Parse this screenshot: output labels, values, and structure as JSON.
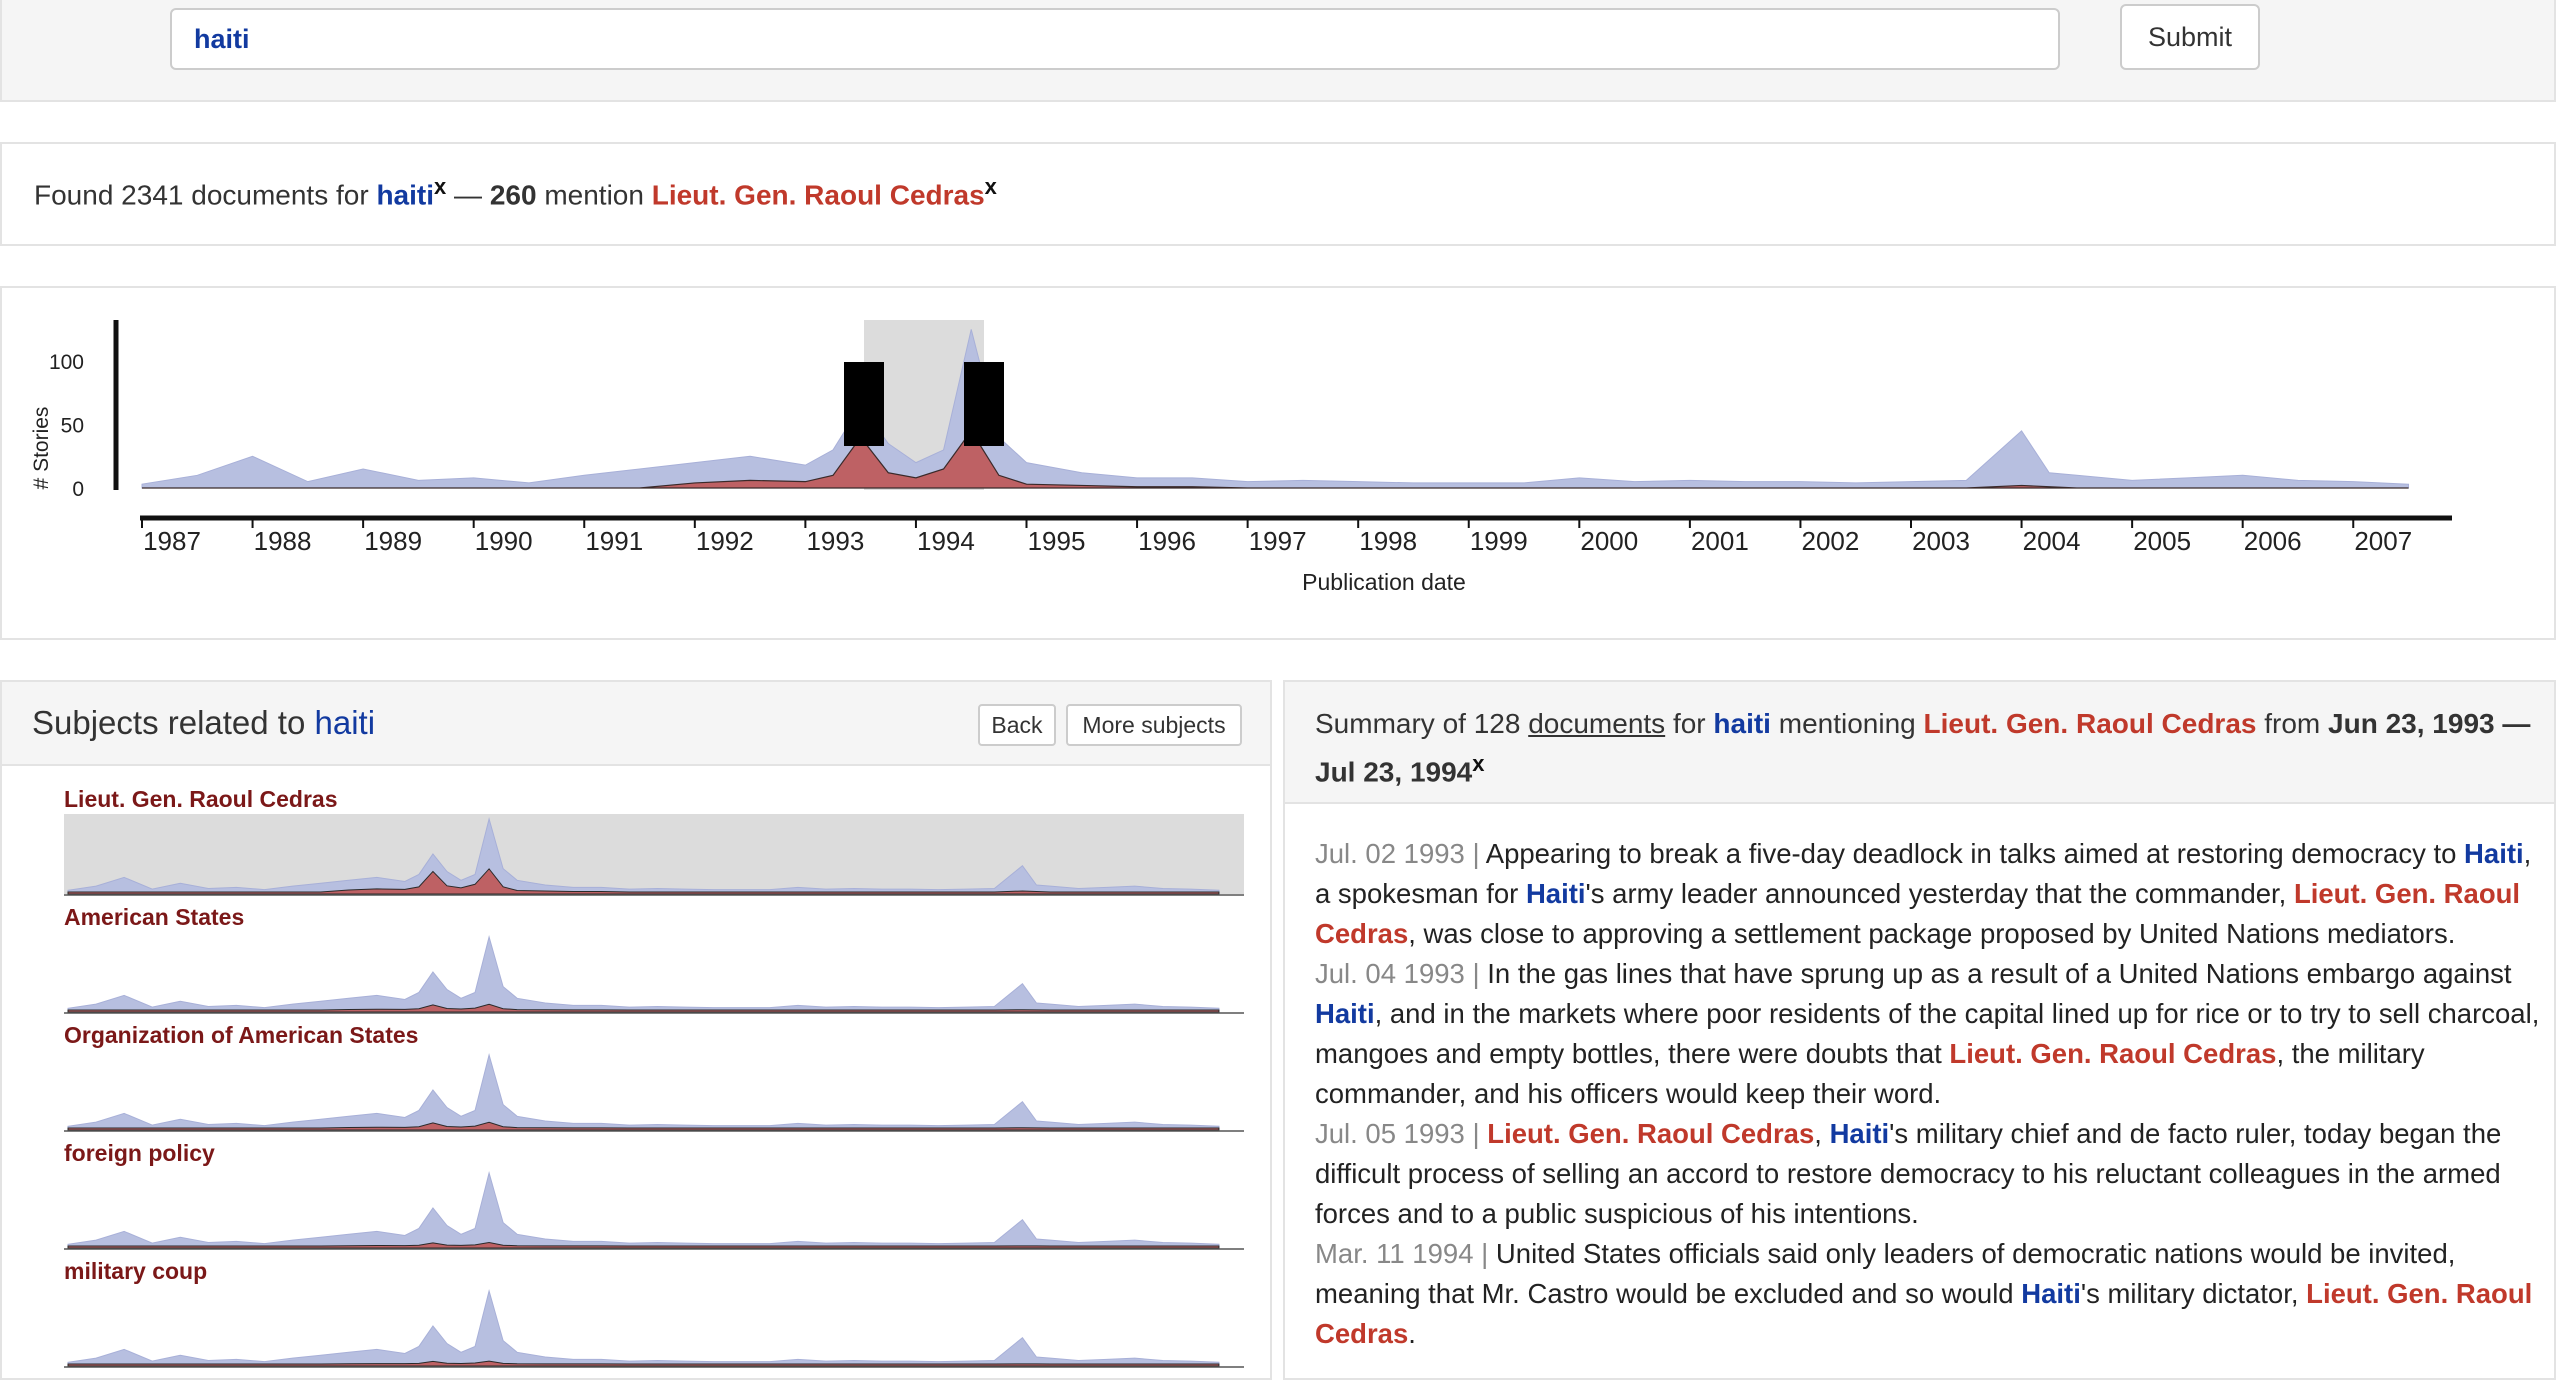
{
  "search": {
    "query": "haiti",
    "submit_label": "Submit"
  },
  "found": {
    "prefix": "Found 2341 documents for ",
    "query": "haiti",
    "x": "x",
    "sep": " — ",
    "count": "260",
    "mention": " mention ",
    "entity": "Lieut. Gen. Raoul Cedras",
    "x2": "x"
  },
  "colors": {
    "query_blue": "#123aa0",
    "entity_red": "#c0392b",
    "area_all": "#b7bfe0",
    "area_entity": "#c0504d",
    "subject_label": "#7b1818"
  },
  "timeline": {
    "ylabel": "# Stories",
    "xlabel": "Publication date",
    "y_ticks": [
      "100",
      "50",
      "0"
    ],
    "years": [
      "1987",
      "1988",
      "1989",
      "1990",
      "1991",
      "1992",
      "1993",
      "1994",
      "1995",
      "1996",
      "1997",
      "1998",
      "1999",
      "2000",
      "2001",
      "2002",
      "2003",
      "2004",
      "2005",
      "2006",
      "2007"
    ],
    "selection": {
      "from": "Jun 23, 1993",
      "to": "Jul 23, 1994"
    }
  },
  "chart_data": {
    "type": "area",
    "title": "",
    "xlabel": "Publication date",
    "ylabel": "# Stories",
    "ylim": [
      0,
      130
    ],
    "x": [
      "1987-01",
      "1987-07",
      "1988-01",
      "1988-07",
      "1989-01",
      "1989-07",
      "1990-01",
      "1990-07",
      "1991-01",
      "1991-07",
      "1992-01",
      "1992-07",
      "1993-01",
      "1993-04",
      "1993-07",
      "1993-10",
      "1994-01",
      "1994-04",
      "1994-07",
      "1994-10",
      "1995-01",
      "1995-07",
      "1996-01",
      "1996-07",
      "1997-01",
      "1997-07",
      "1998-01",
      "1998-07",
      "1999-01",
      "1999-07",
      "2000-01",
      "2000-07",
      "2001-01",
      "2001-07",
      "2002-01",
      "2002-07",
      "2003-01",
      "2003-07",
      "2004-01",
      "2004-04",
      "2004-07",
      "2005-01",
      "2005-07",
      "2006-01",
      "2006-07",
      "2007-01",
      "2007-07"
    ],
    "series": [
      {
        "values": [
          3,
          10,
          25,
          5,
          15,
          6,
          8,
          4,
          10,
          15,
          20,
          25,
          18,
          30,
          65,
          35,
          20,
          30,
          125,
          40,
          20,
          12,
          8,
          8,
          5,
          6,
          5,
          4,
          4,
          4,
          8,
          5,
          6,
          5,
          5,
          4,
          5,
          6,
          45,
          12,
          10,
          6,
          8,
          10,
          6,
          5,
          3
        ]
      },
      {
        "values": [
          0,
          0,
          0,
          0,
          0,
          0,
          0,
          0,
          0,
          0,
          4,
          6,
          5,
          10,
          40,
          12,
          8,
          15,
          45,
          10,
          3,
          2,
          1,
          1,
          0,
          0,
          0,
          0,
          0,
          0,
          0,
          0,
          0,
          0,
          0,
          0,
          0,
          0,
          2,
          1,
          0,
          0,
          0,
          0,
          0,
          0,
          0
        ]
      }
    ]
  },
  "subjects": {
    "title_prefix": "Subjects related to ",
    "query": "haiti",
    "back_label": "Back",
    "more_label": "More subjects",
    "items": [
      {
        "label": "Lieut. Gen. Raoul Cedras"
      },
      {
        "label": "American States"
      },
      {
        "label": "Organization of American States"
      },
      {
        "label": "foreign policy"
      },
      {
        "label": "military coup"
      }
    ]
  },
  "summary": {
    "p1": "Summary of 128 ",
    "docs_link": "documents",
    "p2": " for ",
    "query": "haiti",
    "p3": " mentioning ",
    "entity": "Lieut. Gen. Raoul Cedras",
    "p4": " from ",
    "range": "Jun 23, 1993 — Jul 23, 1994",
    "x": "x"
  },
  "documents": [
    {
      "date": "Jul. 02 1993",
      "parts": [
        {
          "t": "Appearing to break a five-day deadlock in talks aimed at restoring democracy to ",
          "c": ""
        },
        {
          "t": "Haiti",
          "c": "blue"
        },
        {
          "t": ", a spokesman for ",
          "c": ""
        },
        {
          "t": "Haiti",
          "c": "blue"
        },
        {
          "t": "'s army leader announced yesterday that the commander, ",
          "c": ""
        },
        {
          "t": "Lieut. Gen. Raoul Cedras",
          "c": "red"
        },
        {
          "t": ", was close to approving a settlement package proposed by United Nations mediators.",
          "c": ""
        }
      ]
    },
    {
      "date": "Jul. 04 1993",
      "parts": [
        {
          "t": "In the gas lines that have sprung up as a result of a United Nations embargo against ",
          "c": ""
        },
        {
          "t": "Haiti",
          "c": "blue"
        },
        {
          "t": ", and in the markets where poor residents of the capital lined up for rice or to try to sell charcoal, mangoes and empty bottles, there were doubts that ",
          "c": ""
        },
        {
          "t": "Lieut. Gen. Raoul Cedras",
          "c": "red"
        },
        {
          "t": ", the military commander, and his officers would keep their word.",
          "c": ""
        }
      ]
    },
    {
      "date": "Jul. 05 1993",
      "parts": [
        {
          "t": "Lieut. Gen. Raoul Cedras",
          "c": "red"
        },
        {
          "t": ", ",
          "c": ""
        },
        {
          "t": "Haiti",
          "c": "blue"
        },
        {
          "t": "'s military chief and de facto ruler, today began the difficult process of selling an accord to restore democracy to his reluctant colleagues in the armed forces and to a public suspicious of his intentions.",
          "c": ""
        }
      ]
    },
    {
      "date": "Mar. 11 1994",
      "parts": [
        {
          "t": "United States officials said only leaders of democratic nations would be invited, meaning that Mr. Castro would be excluded and so would ",
          "c": ""
        },
        {
          "t": "Haiti",
          "c": "blue"
        },
        {
          "t": "'s military dictator, ",
          "c": ""
        },
        {
          "t": "Lieut. Gen. Raoul Cedras",
          "c": "red"
        },
        {
          "t": ".",
          "c": ""
        }
      ]
    }
  ]
}
